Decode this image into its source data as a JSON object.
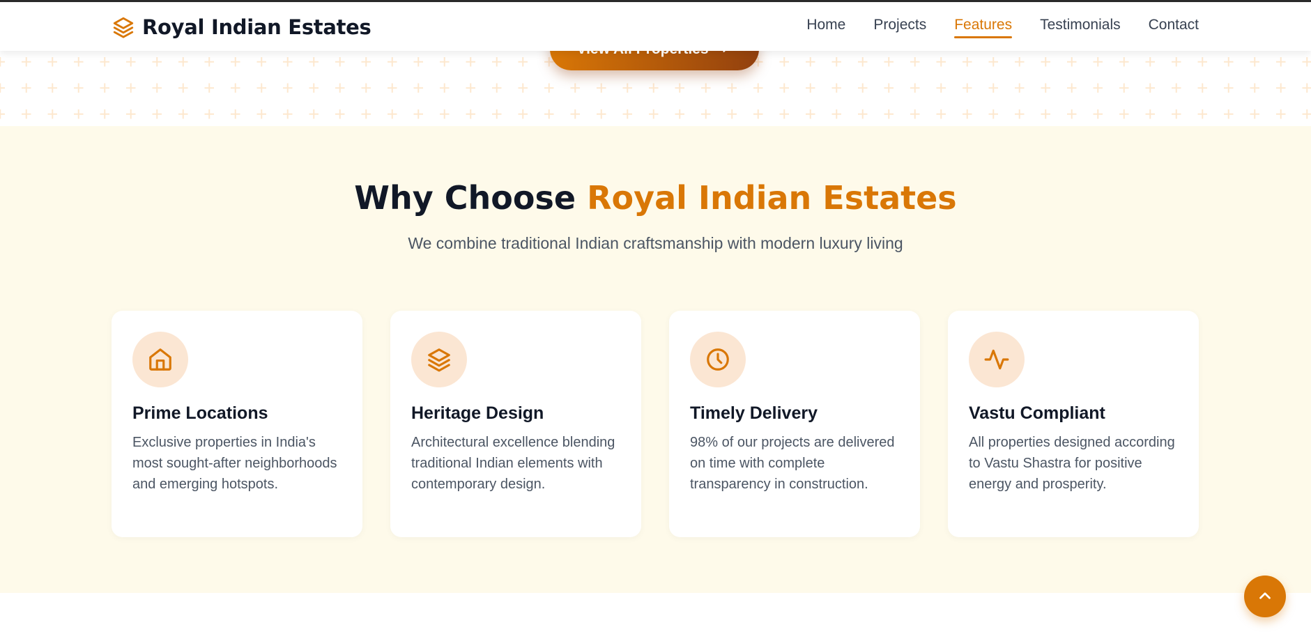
{
  "brand": {
    "name": "Royal Indian Estates",
    "icon": "layers-icon"
  },
  "nav": {
    "items": [
      {
        "label": "Home",
        "active": false
      },
      {
        "label": "Projects",
        "active": false
      },
      {
        "label": "Features",
        "active": true
      },
      {
        "label": "Testimonials",
        "active": false
      },
      {
        "label": "Contact",
        "active": false
      }
    ]
  },
  "hero": {
    "cta_label": "View All Properties",
    "cta_icon": "arrow-right-icon"
  },
  "features": {
    "title_main": "Why Choose ",
    "title_accent": "Royal Indian Estates",
    "subtitle": "We combine traditional Indian craftsmanship with modern luxury living",
    "cards": [
      {
        "icon": "home-icon",
        "title": "Prime Locations",
        "description": "Exclusive properties in India's most sought-after neighborhoods and emerging hotspots."
      },
      {
        "icon": "layers-icon",
        "title": "Heritage Design",
        "description": "Architectural excellence blending traditional Indian elements with contemporary design."
      },
      {
        "icon": "clock-icon",
        "title": "Timely Delivery",
        "description": "98% of our projects are delivered on time with complete transparency in construction."
      },
      {
        "icon": "activity-icon",
        "title": "Vastu Compliant",
        "description": "All properties designed according to Vastu Shastra for positive energy and prosperity."
      }
    ]
  },
  "scroll_top": {
    "icon": "chevron-up-icon"
  },
  "colors": {
    "accent": "#d97706",
    "accent_dark": "#92400e",
    "section_bg": "#fefaea",
    "icon_bg": "#fbe6d3"
  }
}
